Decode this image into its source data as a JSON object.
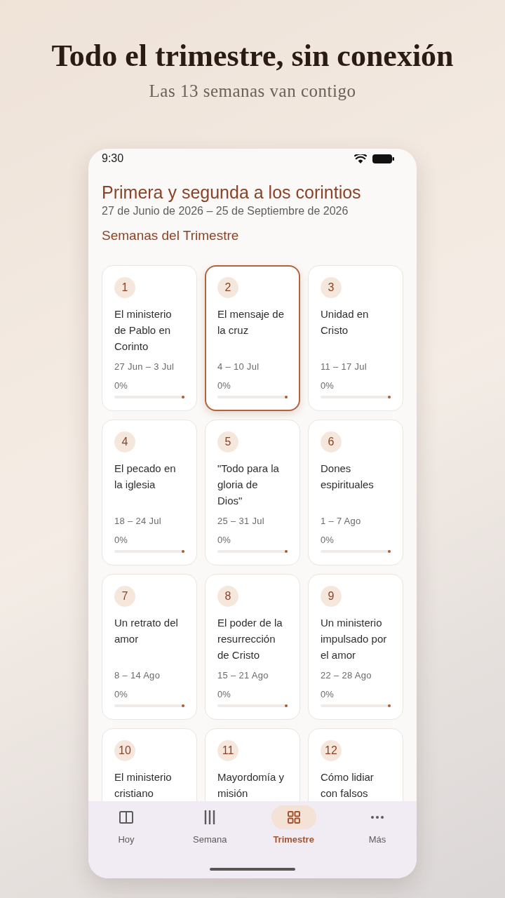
{
  "headline": {
    "title": "Todo el trimestre, sin conexión",
    "subtitle": "Las 13 semanas van contigo"
  },
  "status_bar": {
    "time": "9:30"
  },
  "quarter": {
    "title": "Primera y segunda a los corintios",
    "dates": "27 de Junio de 2026 – 25 de Septiembre de 2026",
    "section_title": "Semanas del Trimestre"
  },
  "weeks": [
    {
      "number": "1",
      "title": "El ministerio de Pablo en Corinto",
      "dates": "27 Jun – 3 Jul",
      "progress": "0%",
      "level": 0,
      "selected": false
    },
    {
      "number": "2",
      "title": "El mensaje de la cruz",
      "dates": "4 – 10 Jul",
      "progress": "0%",
      "level": 0,
      "selected": true
    },
    {
      "number": "3",
      "title": "Unidad en Cristo",
      "dates": "11 – 17 Jul",
      "progress": "0%",
      "level": 0,
      "selected": false
    },
    {
      "number": "4",
      "title": "El pecado en la iglesia",
      "dates": "18 – 24 Jul",
      "progress": "0%",
      "level": 0,
      "selected": false
    },
    {
      "number": "5",
      "title": "\"Todo para la gloria de Dios\"",
      "dates": "25 – 31 Jul",
      "progress": "0%",
      "level": 0,
      "selected": false
    },
    {
      "number": "6",
      "title": "Dones espirituales",
      "dates": "1 – 7 Ago",
      "progress": "0%",
      "level": 0,
      "selected": false
    },
    {
      "number": "7",
      "title": "Un retrato del amor",
      "dates": "8 – 14 Ago",
      "progress": "0%",
      "level": 0,
      "selected": false
    },
    {
      "number": "8",
      "title": "El poder de la resurrección de Cristo",
      "dates": "15 – 21 Ago",
      "progress": "0%",
      "level": 0,
      "selected": false
    },
    {
      "number": "9",
      "title": "Un ministerio impulsado por el amor",
      "dates": "22 – 28 Ago",
      "progress": "0%",
      "level": 0,
      "selected": false
    },
    {
      "number": "10",
      "title": "El ministerio cristiano",
      "selected": false
    },
    {
      "number": "11",
      "title": "Mayordomía y misión",
      "selected": false
    },
    {
      "number": "12",
      "title": "Cómo lidiar con falsos",
      "selected": false
    }
  ],
  "nav": [
    {
      "label": "Hoy",
      "selected": false
    },
    {
      "label": "Semana",
      "selected": false
    },
    {
      "label": "Trimestre",
      "selected": true
    },
    {
      "label": "Más",
      "selected": false
    }
  ]
}
